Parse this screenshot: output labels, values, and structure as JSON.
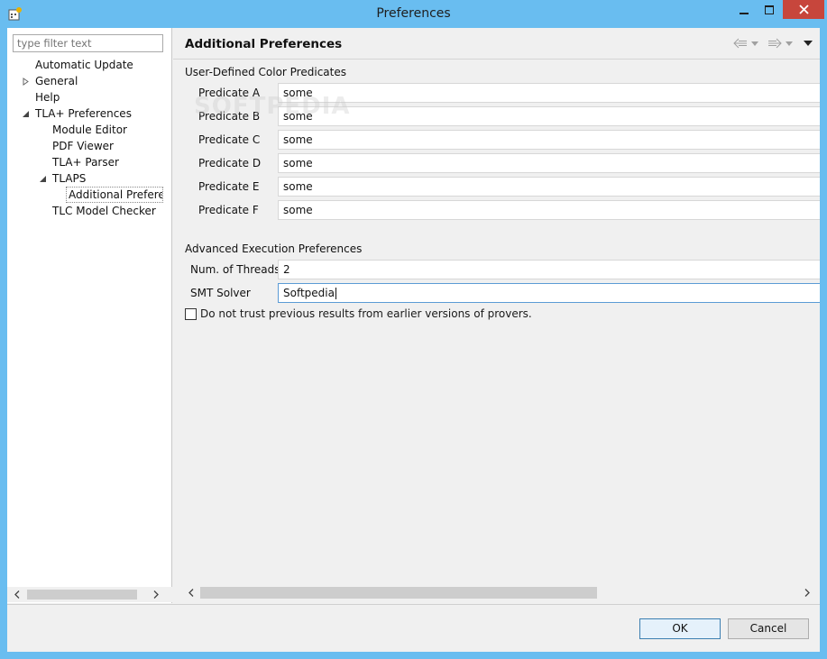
{
  "window": {
    "title": "Preferences",
    "close_glyph": "✕",
    "minimize_glyph": "—",
    "maximize_glyph": "▢"
  },
  "filter": {
    "placeholder": "type filter text"
  },
  "tree": {
    "items": [
      {
        "label": "Automatic Update"
      },
      {
        "label": "General"
      },
      {
        "label": "Help"
      },
      {
        "label": "TLA+ Preferences"
      },
      {
        "label": "Module Editor"
      },
      {
        "label": "PDF Viewer"
      },
      {
        "label": "TLA+ Parser"
      },
      {
        "label": "TLAPS"
      },
      {
        "label": "Additional Preferences"
      },
      {
        "label": "TLC Model Checker"
      }
    ]
  },
  "page": {
    "title": "Additional Preferences",
    "color_group": "User-Defined Color Predicates",
    "predicates": [
      {
        "label": "Predicate A",
        "value": "some"
      },
      {
        "label": "Predicate B",
        "value": "some"
      },
      {
        "label": "Predicate C",
        "value": "some"
      },
      {
        "label": "Predicate D",
        "value": "some"
      },
      {
        "label": "Predicate E",
        "value": "some"
      },
      {
        "label": "Predicate F",
        "value": "some"
      }
    ],
    "exec_group": "Advanced Execution Preferences",
    "threads_label": "Num. of Threads",
    "threads_value": "2",
    "smt_label": "SMT Solver",
    "smt_value": "Softpedia",
    "trust_checkbox_label": "Do not trust previous results from earlier versions of provers.",
    "trust_checked": false
  },
  "buttons": {
    "ok": "OK",
    "cancel": "Cancel"
  },
  "watermark": "SOFTPEDIA",
  "icons": {
    "back": "back-arrow-icon",
    "forward": "forward-arrow-icon",
    "menu": "view-menu-icon"
  }
}
